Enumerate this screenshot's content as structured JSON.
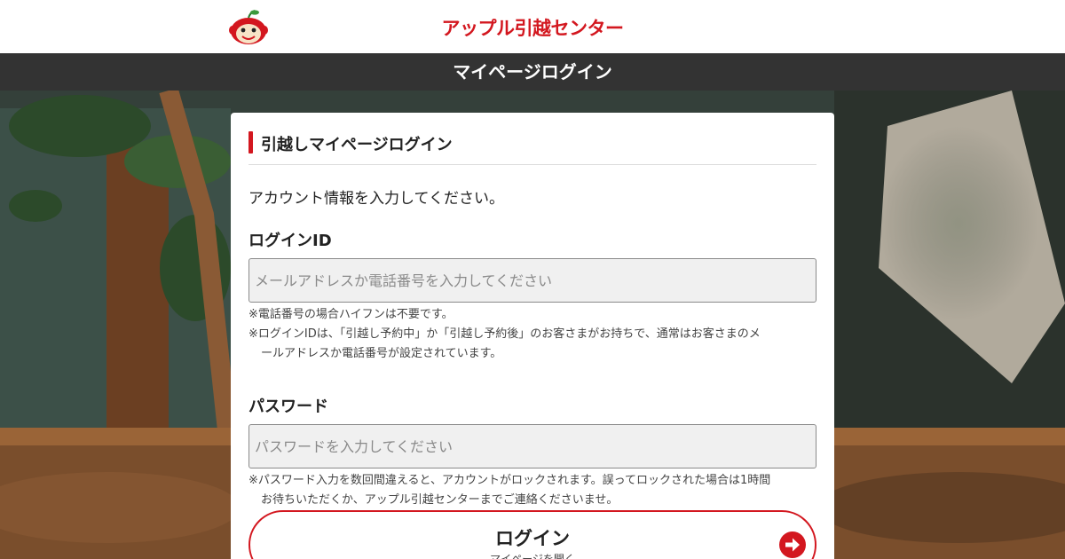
{
  "header": {
    "brand_name": "アップル引越センター",
    "logo_icon": "monkey-mascot-icon",
    "title": "マイページログイン"
  },
  "colors": {
    "accent": "#d3171f",
    "title_bar": "#333333",
    "input_background": "#f0f0f0"
  },
  "login_card": {
    "section_title": "引越しマイページログイン",
    "lead": "アカウント情報を入力してください。",
    "login_id": {
      "label": "ログインID",
      "placeholder": "メールアドレスか電話番号を入力してください",
      "value": "",
      "notes": [
        "※電話番号の場合ハイフンは不要です。",
        "※ログインIDは、「引越し予約中」か「引越し予約後」のお客さまがお持ちで、通常はお客さまのメ",
        "ールアドレスか電話番号が設定されています。"
      ]
    },
    "password": {
      "label": "パスワード",
      "placeholder": "パスワードを入力してください",
      "value": "",
      "notes": [
        "※パスワード入力を数回間違えると、アカウントがロックされます。誤ってロックされた場合は1時間",
        "お待ちいただくか、アップル引越センターまでご連絡くださいませ。"
      ]
    },
    "login_button": {
      "label": "ログイン",
      "sublabel": "マイページを開く",
      "icon": "arrow-right-circle-icon"
    }
  }
}
